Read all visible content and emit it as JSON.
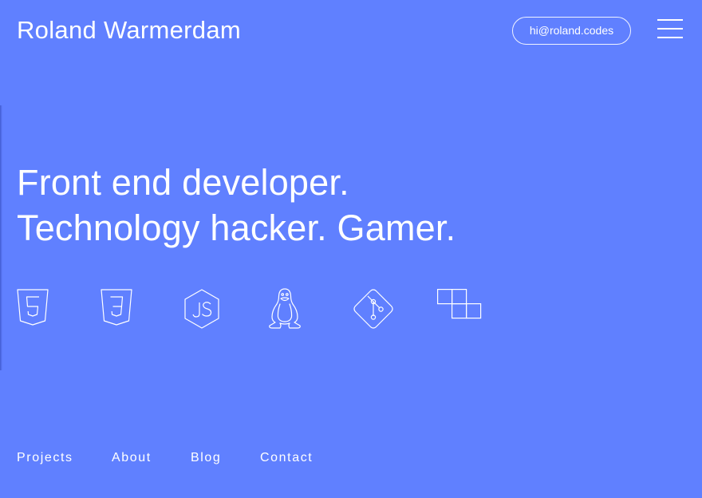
{
  "header": {
    "site_name": "Roland Warmerdam",
    "email": "hi@roland.codes",
    "menu_icon": "hamburger-menu-icon"
  },
  "hero": {
    "lines": [
      "Front end developer.",
      "Technology hacker. Gamer."
    ]
  },
  "tech_icons": [
    {
      "name": "html5-icon"
    },
    {
      "name": "css3-icon"
    },
    {
      "name": "nodejs-icon"
    },
    {
      "name": "linux-tux-icon"
    },
    {
      "name": "git-icon"
    },
    {
      "name": "tetris-blocks-icon"
    }
  ],
  "nav": {
    "items": [
      {
        "label": "Projects"
      },
      {
        "label": "About"
      },
      {
        "label": "Blog"
      },
      {
        "label": "Contact"
      }
    ]
  },
  "colors": {
    "background": "#6080ff",
    "foreground": "#ffffff"
  }
}
